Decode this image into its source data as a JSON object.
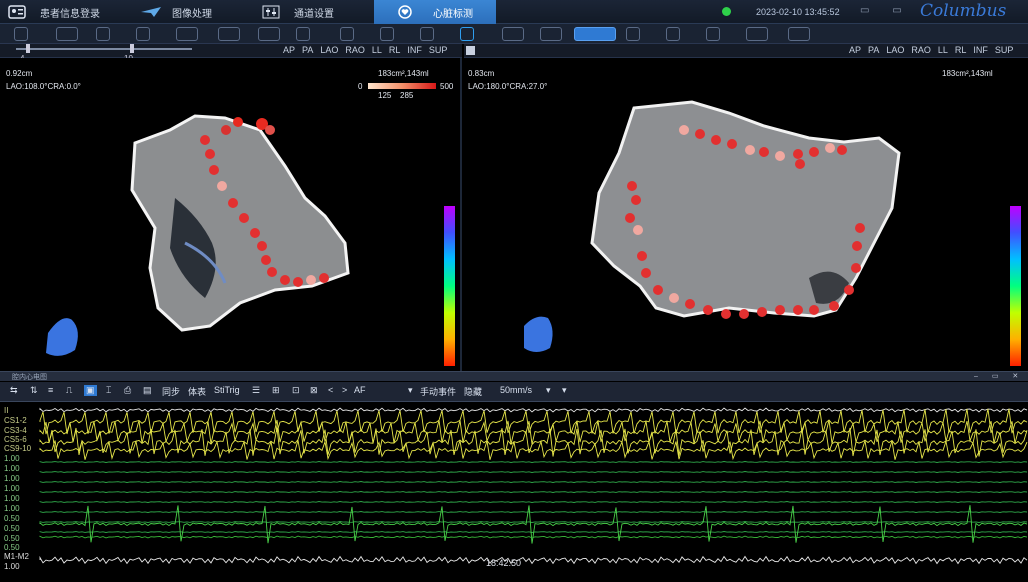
{
  "nav": {
    "tabs": [
      {
        "label": "患者信息登录",
        "icon": "id-card-icon"
      },
      {
        "label": "图像处理",
        "icon": "plane-icon"
      },
      {
        "label": "通道设置",
        "icon": "sliders-icon"
      },
      {
        "label": "心脏标测",
        "icon": "heart-map-icon"
      }
    ],
    "active_tab": 3,
    "datetime": "2023-02-10 13:45:52",
    "logo": "Columbus"
  },
  "view_left": {
    "slider_min": "4",
    "slider_max": "10",
    "views": [
      "AP",
      "PA",
      "LAO",
      "RAO",
      "LL",
      "RL",
      "INF",
      "SUP"
    ],
    "distance": "0.92cm",
    "angle": "LAO:108.0°CRA:0.0°",
    "area_volume": "183cm²,143ml",
    "legend_min": "0",
    "legend_max": "500",
    "legend_mid1": "125",
    "legend_mid2": "285"
  },
  "view_right": {
    "views": [
      "AP",
      "PA",
      "LAO",
      "RAO",
      "LL",
      "RL",
      "INF",
      "SUP"
    ],
    "distance": "0.83cm",
    "angle": "LAO:180.0°CRA:27.0°",
    "area_volume": "183cm²,143ml"
  },
  "ecg": {
    "title": "腔内心电图",
    "tools": {
      "sync": "同步",
      "surface": "体表",
      "stitrig": "StiTrig",
      "af": "AF",
      "manual_event": "手动事件",
      "hide": "隐藏",
      "speed": "50mm/s"
    },
    "leads": [
      "II",
      "CS1-2",
      "CS3-4",
      "CS5-6",
      "CS9-10",
      "1.00",
      "1.00",
      "1.00",
      "1.00",
      "1.00",
      "1.00",
      "0.50",
      "0.50",
      "0.50",
      "0.50",
      "M1-M2",
      "1.00"
    ],
    "timestamp": "18:42:50"
  }
}
